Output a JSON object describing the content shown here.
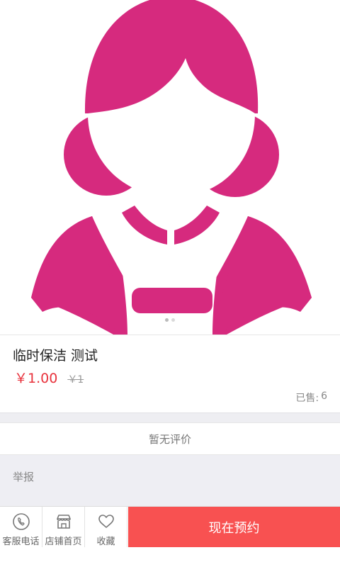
{
  "hero": {
    "image_icon": "housekeeper-avatar-illustration",
    "accent_color": "#d62a7e",
    "carousel_dots": 2,
    "active_dot": 1
  },
  "product": {
    "title": "临时保洁 测试",
    "price": "￥1.00",
    "original_price": "￥1",
    "sold_label": "已售:",
    "sold_count": "6",
    "price_color": "#e8323c"
  },
  "reviews": {
    "empty_text": "暂无评价"
  },
  "report": {
    "label": "举报"
  },
  "bottom_bar": {
    "service_phone": {
      "label": "客服电话",
      "icon": "phone-icon"
    },
    "store_home": {
      "label": "店铺首页",
      "icon": "store-icon"
    },
    "favorite": {
      "label": "收藏",
      "icon": "heart-icon"
    },
    "book_now": {
      "label": "现在预约",
      "color": "#f85151"
    }
  }
}
